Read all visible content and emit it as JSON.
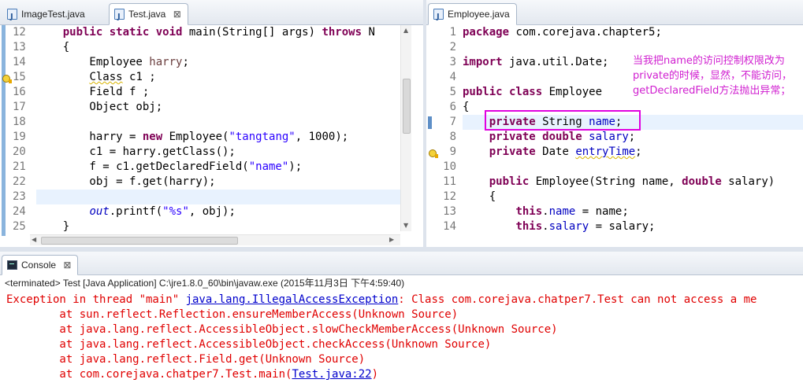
{
  "left_tabs": [
    {
      "label": "ImageTest.java",
      "active": false
    },
    {
      "label": "Test.java",
      "active": true,
      "close": "⊠"
    }
  ],
  "right_tabs": [
    {
      "label": "Employee.java",
      "active": true
    }
  ],
  "left_editor": {
    "line_numbers": [
      "12",
      "13",
      "14",
      "15",
      "16",
      "17",
      "18",
      "19",
      "20",
      "21",
      "22",
      "23",
      "24",
      "25"
    ],
    "current_line": "23",
    "warning_line": "15"
  },
  "right_editor": {
    "line_numbers": [
      "1",
      "2",
      "3",
      "4",
      "5",
      "6",
      "7",
      "8",
      "9",
      "10",
      "11",
      "12",
      "13",
      "14"
    ],
    "warning_line": "9"
  },
  "annotation": {
    "text": "当我把name的访问控制权限改为 private的时候，显然，不能访问，getDeclaredField方法抛出异常；",
    "color": "#e000e0"
  },
  "console": {
    "tab_label": "Console",
    "tab_close": "⊠",
    "status": "<terminated> Test [Java Application] C:\\jre1.8.0_60\\bin\\javaw.exe (2015年11月3日 下午4:59:40)",
    "exception_prefix": "Exception in thread \"main\" ",
    "exception_link": "java.lang.IllegalAccessException",
    "exception_suffix": ": Class com.corejava.chatper7.Test can not access a me",
    "stack": [
      "        at sun.reflect.Reflection.ensureMemberAccess(Unknown Source)",
      "        at java.lang.reflect.AccessibleObject.slowCheckMemberAccess(Unknown Source)",
      "        at java.lang.reflect.AccessibleObject.checkAccess(Unknown Source)",
      "        at java.lang.reflect.Field.get(Unknown Source)"
    ],
    "last_prefix": "        at com.corejava.chatper7.Test.main(",
    "last_link": "Test.java:22",
    "last_suffix": ")"
  },
  "colors": {
    "keyword": "#7f0055",
    "string": "#2a00ff",
    "field": "#0000c0",
    "error": "#e00000"
  }
}
